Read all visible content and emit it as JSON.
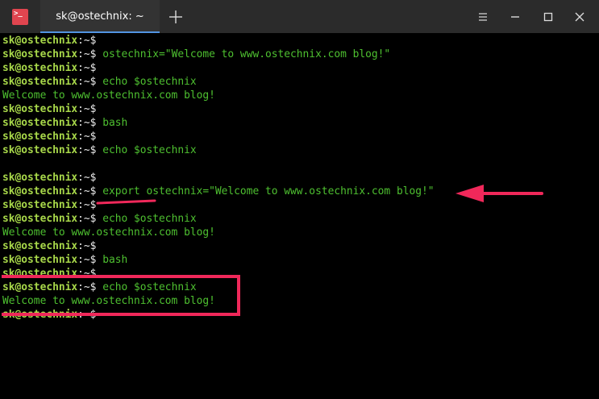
{
  "titlebar": {
    "app_icon_glyph": ">_",
    "tab_title": "sk@ostechnix: ~"
  },
  "icons": {
    "app": "terminal-icon",
    "new_tab": "plus-icon",
    "menu": "hamburger-menu-icon",
    "minimize": "minimize-icon",
    "maximize": "maximize-icon",
    "close": "close-icon"
  },
  "terminal": {
    "prompt": {
      "user": "sk@ostechnix",
      "sep": ":",
      "path": "~",
      "dollar": "$"
    },
    "lines": [
      {
        "type": "prompt",
        "cmd": ""
      },
      {
        "type": "prompt",
        "cmd": "ostechnix=\"Welcome to www.ostechnix.com blog!\""
      },
      {
        "type": "prompt",
        "cmd": ""
      },
      {
        "type": "prompt",
        "cmd": "echo $ostechnix"
      },
      {
        "type": "output",
        "text": "Welcome to www.ostechnix.com blog!"
      },
      {
        "type": "prompt",
        "cmd": ""
      },
      {
        "type": "prompt",
        "cmd": "bash"
      },
      {
        "type": "prompt",
        "cmd": ""
      },
      {
        "type": "prompt",
        "cmd": "echo $ostechnix"
      },
      {
        "type": "output",
        "text": ""
      },
      {
        "type": "prompt",
        "cmd": ""
      },
      {
        "type": "prompt",
        "cmd": "export ostechnix=\"Welcome to www.ostechnix.com blog!\""
      },
      {
        "type": "prompt",
        "cmd": ""
      },
      {
        "type": "prompt",
        "cmd": "echo $ostechnix"
      },
      {
        "type": "output",
        "text": "Welcome to www.ostechnix.com blog!"
      },
      {
        "type": "prompt",
        "cmd": ""
      },
      {
        "type": "prompt",
        "cmd": "bash"
      },
      {
        "type": "prompt",
        "cmd": ""
      },
      {
        "type": "prompt",
        "cmd": "echo $ostechnix"
      },
      {
        "type": "output",
        "text": "Welcome to www.ostechnix.com blog!"
      },
      {
        "type": "prompt",
        "cmd": ""
      }
    ]
  },
  "colors": {
    "annotation": "#f0285a",
    "tab_accent": "#5294e2",
    "prompt_user": "#a8d84a",
    "text_green": "#4ec030"
  }
}
